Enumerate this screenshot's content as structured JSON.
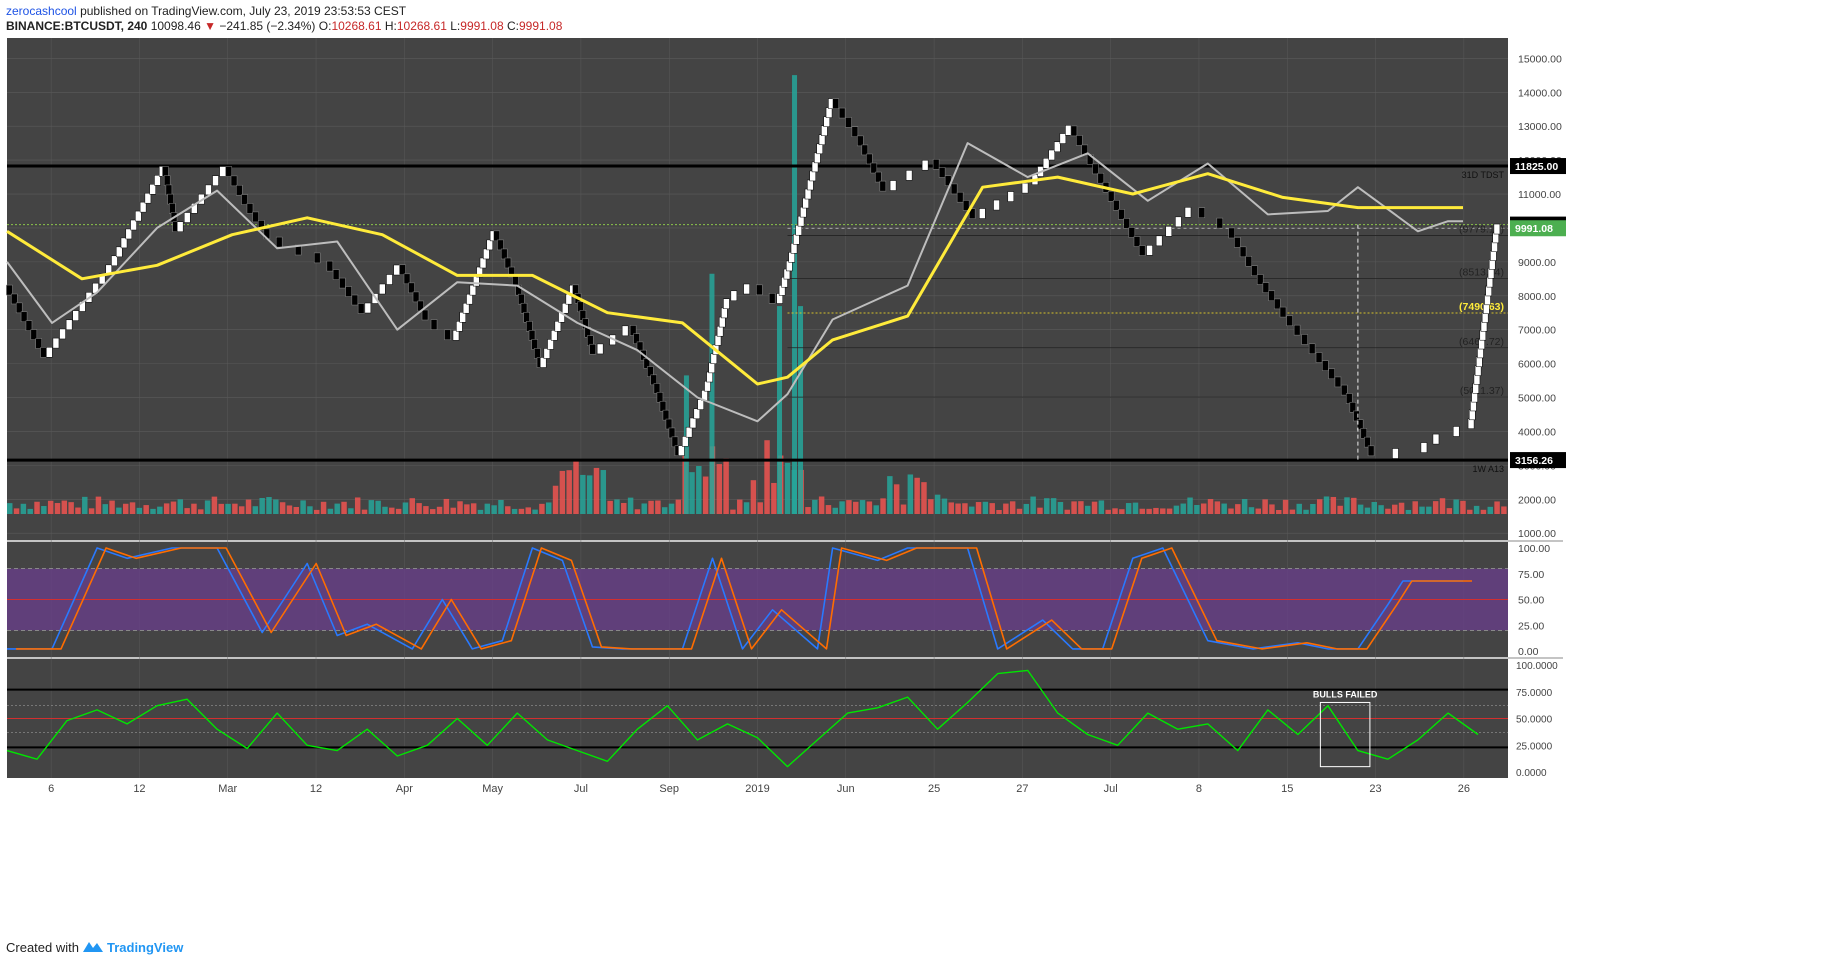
{
  "header": {
    "author": "zerocashcool",
    "published": "published on TradingView.com, July 23, 2019 23:53:53 CEST",
    "symbol": "BINANCE:BTCUSDT, 240",
    "last": "10098.46",
    "change_arrow": "▼",
    "change": "−241.85 (−2.34%)",
    "o_label": "O:",
    "o": "10268.61",
    "h_label": "H:",
    "h": "10268.61",
    "l_label": "L:",
    "l": "9991.08",
    "c_label": "C:",
    "c": "9991.08"
  },
  "footer": {
    "created": "Created with",
    "brand": "TradingView"
  },
  "colors": {
    "panel_bg": "#444444",
    "grid": "#5a5a5a",
    "yellow_ma": "#ffeb3b",
    "grey_ma": "#bdbdbd",
    "vol_up": "#26a69a",
    "vol_down": "#ef5350",
    "stoch_k": "#2979ff",
    "stoch_d": "#ff6d00",
    "stoch_band": "#6a3d8c",
    "rsi_line": "#00e600",
    "midline_red": "#d32f2f"
  },
  "chart_data": {
    "type": "line",
    "title": "BINANCE:BTCUSDT, 240",
    "x_ticks": [
      "6",
      "12",
      "Mar",
      "12",
      "Apr",
      "May",
      "Jul",
      "Sep",
      "2019",
      "Jun",
      "25",
      "27",
      "Jul",
      "8",
      "15",
      "23",
      "26"
    ],
    "main_panel": {
      "y_axis_ticks": [
        15000,
        14000,
        13000,
        12000,
        11000,
        10000,
        9000,
        8000,
        7000,
        6000,
        5000,
        4000,
        3000,
        2000,
        1000
      ],
      "y_axis_tick_labels": [
        "15000.00",
        "14000.00",
        "13000.00",
        "12000.00",
        "11000.00",
        "10000.00",
        "9000.00",
        "8000.00",
        "7000.00",
        "6000.00",
        "5000.00",
        "4000.00",
        "3000.00",
        "2000.00",
        "1000.00"
      ],
      "ylim": [
        800,
        15600
      ],
      "price_series_x": [
        0,
        0.026,
        0.07,
        0.105,
        0.113,
        0.146,
        0.16,
        0.175,
        0.213,
        0.238,
        0.262,
        0.28,
        0.298,
        0.325,
        0.34,
        0.356,
        0.378,
        0.391,
        0.416,
        0.432,
        0.448,
        0.466,
        0.48,
        0.497,
        0.514,
        0.522,
        0.55,
        0.567,
        0.585,
        0.617,
        0.645,
        0.683,
        0.709,
        0.727,
        0.758,
        0.79,
        0.814,
        0.833,
        0.852,
        0.872,
        0.893,
        0.91,
        0.94,
        0.956,
        0.975,
        0.993
      ],
      "price_series": [
        8300,
        6200,
        8900,
        11800,
        9900,
        11800,
        10700,
        9700,
        9000,
        7500,
        8900,
        7300,
        6700,
        9900,
        8300,
        5900,
        8300,
        6300,
        7100,
        5400,
        3300,
        5200,
        7900,
        8300,
        7800,
        9000,
        13800,
        12700,
        11100,
        12000,
        10300,
        11300,
        13000,
        11600,
        9200,
        10600,
        9991,
        8600,
        7400,
        6300,
        5100,
        3300,
        3400,
        3900,
        4100,
        10098
      ],
      "ma_yellow_x": [
        0,
        0.05,
        0.1,
        0.15,
        0.2,
        0.25,
        0.3,
        0.35,
        0.4,
        0.45,
        0.5,
        0.52,
        0.55,
        0.6,
        0.65,
        0.7,
        0.75,
        0.8,
        0.85,
        0.9,
        0.95,
        0.97
      ],
      "ma_yellow": [
        9900,
        8500,
        8900,
        9800,
        10300,
        9800,
        8600,
        8600,
        7500,
        7200,
        5400,
        5600,
        6700,
        7400,
        11200,
        11500,
        11000,
        11600,
        10900,
        10600,
        10600,
        10600
      ],
      "ma_grey_x": [
        0,
        0.03,
        0.06,
        0.1,
        0.14,
        0.18,
        0.22,
        0.26,
        0.3,
        0.34,
        0.38,
        0.42,
        0.46,
        0.5,
        0.52,
        0.55,
        0.6,
        0.64,
        0.68,
        0.72,
        0.76,
        0.8,
        0.84,
        0.88,
        0.9,
        0.94,
        0.96,
        0.97
      ],
      "ma_grey": [
        9000,
        7200,
        8100,
        10000,
        11100,
        9400,
        9600,
        7000,
        8400,
        8300,
        7200,
        6400,
        5000,
        4300,
        5100,
        7300,
        8300,
        12500,
        11500,
        12200,
        10800,
        11900,
        10400,
        10500,
        11200,
        9900,
        10200,
        10200
      ],
      "horizontal_levels": [
        {
          "value": 11825.0,
          "label": "11825.00",
          "note": "31D TDST",
          "style": "solid-black"
        },
        {
          "value": 3156.26,
          "label": "3156.26",
          "note": "1W A13",
          "style": "solid-black"
        },
        {
          "value": 10098.44,
          "label": "10098.44",
          "style": "dotted-green"
        },
        {
          "value": 9991.08,
          "label": "9991.08",
          "style": "badge-green"
        },
        {
          "value": 9779.16,
          "label": "(9779.16)",
          "style": "thin-grey"
        },
        {
          "value": 8513.54,
          "label": "(8513.54)",
          "style": "thin-grey"
        },
        {
          "value": 7490.63,
          "label": "(7490.63)",
          "style": "dotted-yellow"
        },
        {
          "value": 6467.72,
          "label": "(6467.72)",
          "style": "thin-grey"
        },
        {
          "value": 5011.37,
          "label": "(5011.37)",
          "style": "thin-grey"
        }
      ]
    },
    "stoch_panel": {
      "y_axis_tick_labels": [
        "100.00",
        "75.00",
        "50.00",
        "25.00",
        "0.00"
      ],
      "ylim": [
        0,
        100
      ],
      "band": [
        20,
        80
      ],
      "midline": 50,
      "k_x": [
        0,
        0.03,
        0.06,
        0.08,
        0.11,
        0.14,
        0.17,
        0.2,
        0.22,
        0.24,
        0.27,
        0.29,
        0.31,
        0.33,
        0.35,
        0.37,
        0.39,
        0.41,
        0.43,
        0.45,
        0.47,
        0.49,
        0.51,
        0.54,
        0.55,
        0.58,
        0.6,
        0.63,
        0.64,
        0.66,
        0.69,
        0.71,
        0.73,
        0.75,
        0.77,
        0.8,
        0.83,
        0.86,
        0.88,
        0.9,
        0.92,
        0.93,
        0.95,
        0.97
      ],
      "k": [
        2,
        2,
        100,
        90,
        100,
        100,
        18,
        85,
        15,
        26,
        2,
        50,
        2,
        10,
        100,
        88,
        4,
        2,
        2,
        2,
        90,
        2,
        40,
        2,
        100,
        88,
        100,
        100,
        100,
        2,
        30,
        2,
        2,
        90,
        100,
        10,
        2,
        8,
        2,
        2,
        45,
        68,
        68,
        68
      ]
    },
    "rsi_panel": {
      "y_axis_tick_labels": [
        "100.0000",
        "75.0000",
        "50.0000",
        "25.0000",
        "0.0000"
      ],
      "ylim": [
        0,
        100
      ],
      "levels": [
        77,
        50,
        23
      ],
      "dotted_levels": [
        62,
        37
      ],
      "values_x": [
        0,
        0.02,
        0.04,
        0.06,
        0.08,
        0.1,
        0.12,
        0.14,
        0.16,
        0.18,
        0.2,
        0.22,
        0.24,
        0.26,
        0.28,
        0.3,
        0.32,
        0.34,
        0.36,
        0.38,
        0.4,
        0.42,
        0.44,
        0.46,
        0.48,
        0.5,
        0.52,
        0.54,
        0.56,
        0.58,
        0.6,
        0.62,
        0.64,
        0.66,
        0.68,
        0.7,
        0.72,
        0.74,
        0.76,
        0.78,
        0.8,
        0.82,
        0.84,
        0.86,
        0.88,
        0.9,
        0.92,
        0.94,
        0.96,
        0.98
      ],
      "values": [
        20,
        12,
        48,
        58,
        45,
        62,
        68,
        40,
        22,
        55,
        25,
        20,
        40,
        15,
        25,
        50,
        25,
        55,
        30,
        20,
        10,
        40,
        62,
        30,
        45,
        32,
        5,
        30,
        55,
        60,
        70,
        40,
        65,
        92,
        95,
        55,
        35,
        25,
        55,
        40,
        45,
        20,
        58,
        35,
        62,
        20,
        12,
        30,
        55,
        35
      ],
      "annotation": "BULLS FAILED"
    }
  }
}
